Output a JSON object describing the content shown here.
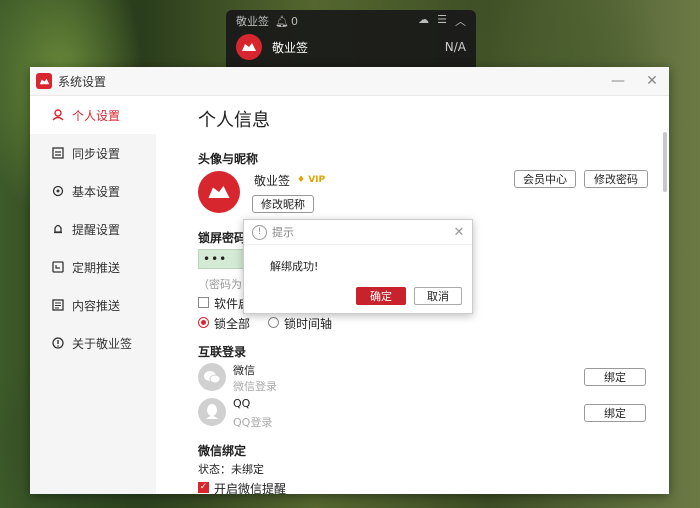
{
  "mini_widget": {
    "app_name_small": "敬业签",
    "count": "0",
    "app_name": "敬业签",
    "value": "N/A"
  },
  "window": {
    "title": "系统设置",
    "minimize": "—",
    "close": "✕"
  },
  "sidebar": {
    "items": [
      {
        "label": "个人设置",
        "icon": "person-icon",
        "active": true
      },
      {
        "label": "同步设置",
        "icon": "sync-icon",
        "active": false
      },
      {
        "label": "基本设置",
        "icon": "gear-icon",
        "active": false
      },
      {
        "label": "提醒设置",
        "icon": "bell-icon",
        "active": false
      },
      {
        "label": "定期推送",
        "icon": "calendar-icon",
        "active": false
      },
      {
        "label": "内容推送",
        "icon": "document-icon",
        "active": false
      },
      {
        "label": "关于敬业签",
        "icon": "info-icon",
        "active": false
      }
    ]
  },
  "main": {
    "heading": "个人信息",
    "avatar_section": "头像与昵称",
    "nickname": "敬业签",
    "vip_badge": "VIP",
    "edit_nickname": "修改昵称",
    "member_center": "会员中心",
    "change_password": "修改密码",
    "lock_section": "锁屏密码",
    "password_dots": "•••",
    "password_hint": "（密码为",
    "software_start": "软件启",
    "lock_all": "锁全部",
    "lock_timeline": "锁时间轴",
    "social_section": "互联登录",
    "wechat_name": "微信",
    "wechat_sub": "微信登录",
    "wechat_bind": "绑定",
    "qq_name": "QQ",
    "qq_sub": "QQ登录",
    "qq_bind": "绑定",
    "wechat_bind_section": "微信绑定",
    "status": "状态：未绑定",
    "enable_wechat_reminder": "开启微信提醒"
  },
  "dialog": {
    "title": "提示",
    "message": "解绑成功!",
    "ok": "确定",
    "cancel": "取消"
  },
  "colors": {
    "accent": "#d8262f",
    "ok_button": "#c8232c",
    "password_field": "#d4ead4"
  }
}
